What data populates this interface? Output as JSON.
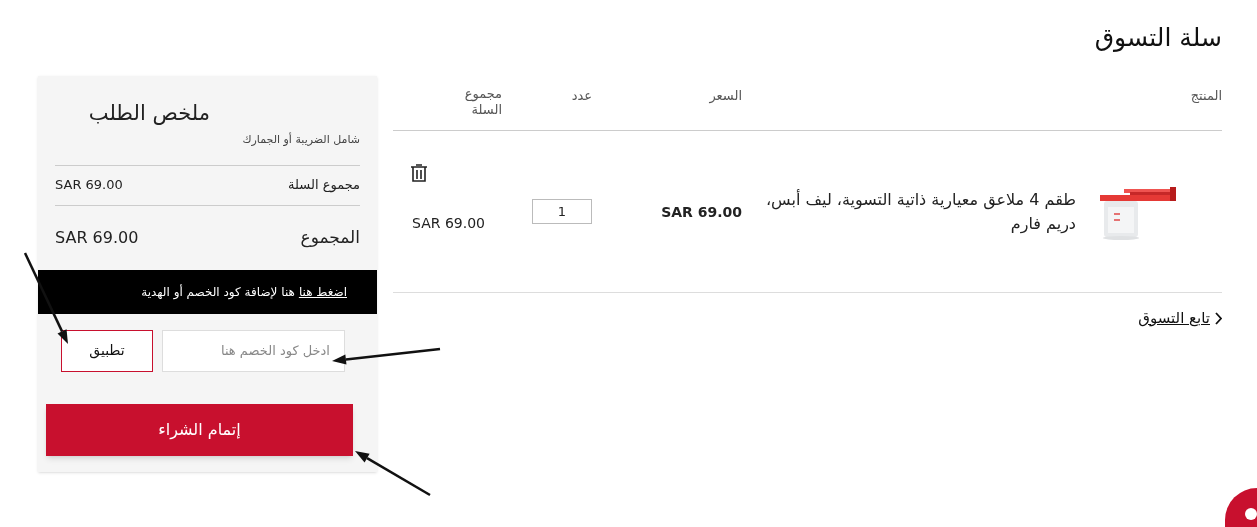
{
  "page_title": "سلة التسوق",
  "cart": {
    "columns": [
      "المنتج",
      "السعر",
      "عدد",
      "مجموع السلة"
    ],
    "items": [
      {
        "name": "طقم 4 ملاعق معيارية ذاتية التسوية، ليف أبس، دريم فارم",
        "price": "SAR 69.00",
        "quantity": "1",
        "total": "SAR 69.00"
      }
    ],
    "continue_link": "تابع التسوق"
  },
  "summary": {
    "title": "ملخص الطلب",
    "note": "شامل الضريبة أو الجمارك",
    "rows": [
      {
        "label": "مجموع السلة",
        "value": "SAR 69.00",
        "kind": "subtotal"
      },
      {
        "label": "المجموع",
        "value": "SAR 69.00",
        "kind": "total"
      }
    ],
    "promo": {
      "link": "اضغط هنا",
      "text": "هنا لإضافة كود الخصم أو الهدية",
      "placeholder": "ادخل كود الخصم هنا",
      "apply": "تطبيق"
    },
    "checkout": "إتمام الشراء"
  }
}
